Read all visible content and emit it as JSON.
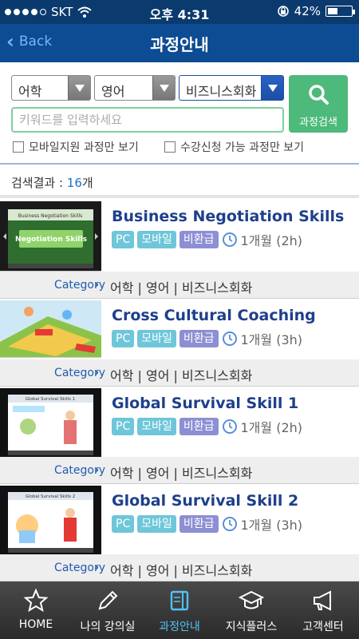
{
  "status_bar": {
    "carrier": "SKT",
    "time": "오후 4:31",
    "battery": "42%",
    "battery_fraction": 0.42
  },
  "nav": {
    "back_label": "Back",
    "title": "과정안내"
  },
  "search": {
    "select1": "어학",
    "select2": "영어",
    "select3": "비즈니스회화",
    "keyword_placeholder": "키워드를 입력하세요",
    "button_label": "과정검색",
    "check_mobile": "모바일지원 과정만 보기",
    "check_available": "수강신청 가능 과정만 보기"
  },
  "results": {
    "label": "검색결과 : ",
    "count": "16",
    "unit": "개"
  },
  "courses": [
    {
      "title": "Business Negotiation Skills",
      "tags": [
        "PC",
        "모바일",
        "비환급"
      ],
      "duration": "1개월 (2h)",
      "category_label": "Category",
      "category": "어학 | 영어 | 비즈니스회화"
    },
    {
      "title": "Cross Cultural Coaching",
      "tags": [
        "PC",
        "모바일",
        "비환급"
      ],
      "duration": "1개월 (3h)",
      "category_label": "Category",
      "category": "어학 | 영어 | 비즈니스회화"
    },
    {
      "title": "Global Survival Skill 1",
      "tags": [
        "PC",
        "모바일",
        "비환급"
      ],
      "duration": "1개월 (2h)",
      "category_label": "Category",
      "category": "어학 | 영어 | 비즈니스회화"
    },
    {
      "title": "Global Survival Skill 2",
      "tags": [
        "PC",
        "모바일",
        "비환급"
      ],
      "duration": "1개월 (3h)",
      "category_label": "Category",
      "category": "어학 | 영어 | 비즈니스회화"
    }
  ],
  "thumb_text": {
    "t1_top": "Business Negotiation Skills",
    "t1_main": "Negotiation Skills",
    "t3_top": "Global Survival Skills 1",
    "t4_top": "Global Survival Skills 2"
  },
  "tabbar": {
    "home": "HOME",
    "my_class": "나의 강의실",
    "courses": "과정안내",
    "knowledge": "지식플러스",
    "support": "고객센터"
  },
  "colors": {
    "nav": "#0d4b93",
    "search_button": "#4db97a",
    "title": "#1e3f8c",
    "active_tab": "#4fc3f7"
  }
}
